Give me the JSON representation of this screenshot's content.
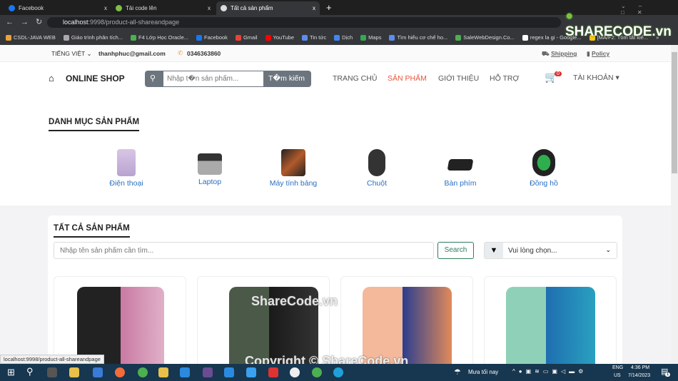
{
  "browser": {
    "tabs": [
      {
        "label": "Facebook",
        "close": "x"
      },
      {
        "label": "Tải code lên",
        "close": "x"
      },
      {
        "label": "Tất cả sản phẩm",
        "close": "x"
      }
    ],
    "new_tab": "+",
    "url_host": "localhost",
    "url_path": ":9998/product-all-shareandpage",
    "bookmarks": [
      "CSDL-JAVA WEB",
      "Giáo trình phân tích...",
      "F4 Lớp Học Oracle...",
      "Facebook",
      "Gmail",
      "YouTube",
      "Tin tức",
      "Dịch",
      "Maps",
      "Tìm hiểu cơ chế ho...",
      "SaleWebDesign.Co...",
      "regex la gi - Google...",
      "[MA/F2: Tóm tắt kiế..."
    ],
    "more": "»"
  },
  "topbar": {
    "language": "TIẾNG VIỆT",
    "email": "thanhphuc@gmail.com",
    "phone": "0346363860",
    "shipping": "Shipping",
    "policy": "Policy"
  },
  "header": {
    "logo": "ONLINE SHOP",
    "search_placeholder": "Nhập t�n sản phẩm...",
    "search_button": "T�m kiếm",
    "nav": [
      "TRANG CHỦ",
      "SẢN PHẨM",
      "GIỚI THIỆU",
      "HỖ TRỢ"
    ],
    "active_nav": "SẢN PHẨM",
    "cart_count": "0",
    "account": "TÀI KHOẢN"
  },
  "categories": {
    "title": "DANH MỤC SẢN PHẨM",
    "items": [
      "Điện thoại",
      "Laptop",
      "Máy tính bảng",
      "Chuột",
      "Bàn phím",
      "Đồng hồ"
    ]
  },
  "products": {
    "title": "TẤT CẢ SẢN PHẨM",
    "search_placeholder": "Nhập tên sản phẩm cần tìm...",
    "search_button": "Search",
    "filter_value": "Vui lòng chọn..."
  },
  "status_url": "localhost:9998/product-all-shareandpage",
  "watermark": {
    "logo": "SHARECODE.vn",
    "center": "ShareCode.vn",
    "bottom": "Copyright © ShareCode.vn"
  },
  "taskbar": {
    "weather": "Mưa tối nay",
    "lang1": "ENG",
    "lang2": "US",
    "time": "4:36 PM",
    "date": "7/14/2023",
    "notifications": "1"
  },
  "colors": {
    "accent": "#e8553e",
    "link": "#2a6fbf",
    "search_btn": "#6c757d"
  }
}
